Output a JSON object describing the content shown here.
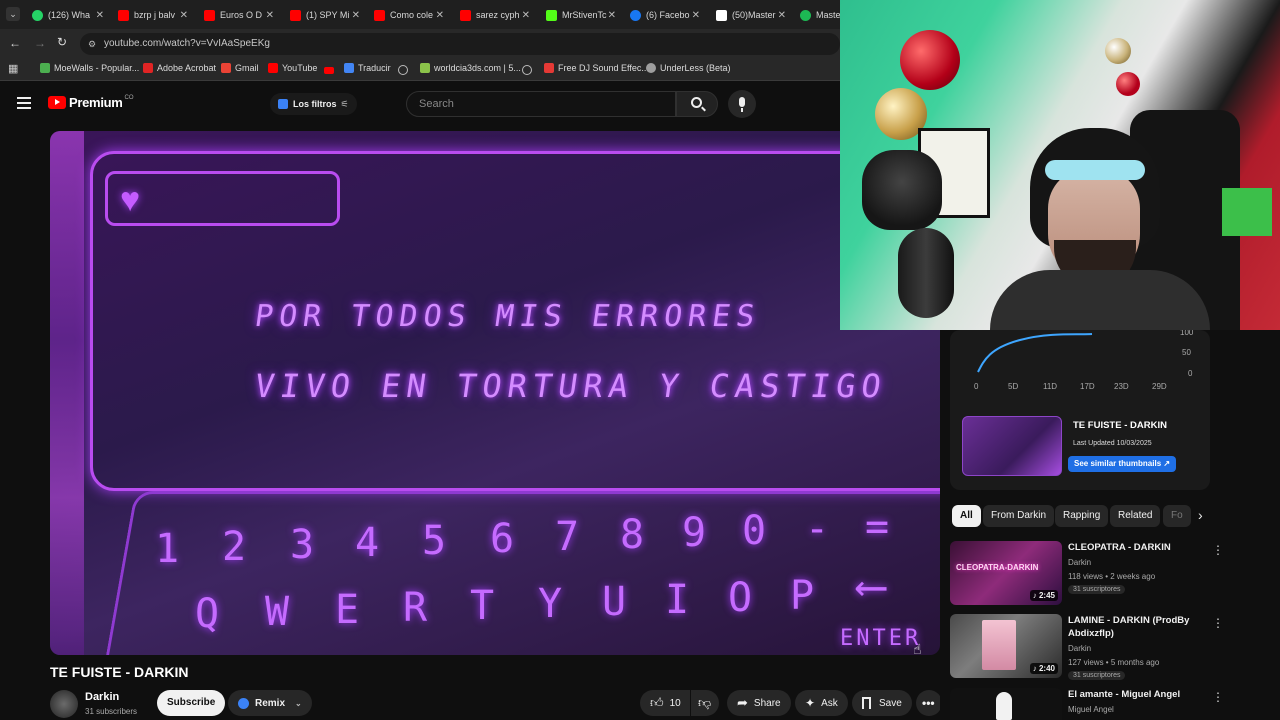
{
  "tabs": [
    {
      "label": "(126) Wha",
      "color": "#25d366"
    },
    {
      "label": "bzrp j balv",
      "color": "#ff0000"
    },
    {
      "label": "Euros O D",
      "color": "#ff0000"
    },
    {
      "label": "(1) SPY Mi",
      "color": "#ff0000"
    },
    {
      "label": "Como cole",
      "color": "#ff0000"
    },
    {
      "label": "sarez cyph",
      "color": "#ff0000"
    },
    {
      "label": "MrStivenTc",
      "color": "#53fc18"
    },
    {
      "label": "(6) Facebo",
      "color": "#1877f2"
    },
    {
      "label": "(50)Master",
      "color": "#ffffff"
    },
    {
      "label": "Master",
      "color": "#1db954"
    }
  ],
  "address": {
    "url": "youtube.com/watch?v=VvIAaSpeEKg"
  },
  "bookmarks": [
    {
      "label": "MoeWalls - Popular...",
      "color": "#4caf50"
    },
    {
      "label": "Adobe Acrobat",
      "color": "#e02424"
    },
    {
      "label": "Gmail",
      "color": "#ea4335"
    },
    {
      "label": "YouTube",
      "color": "#ff0000"
    },
    {
      "label": "Traducir",
      "color": "#4285f4"
    },
    {
      "label": "worldcia3ds.com | 5...",
      "color": "#8bc34a"
    },
    {
      "label": "Free DJ Sound Effec...",
      "color": "#e53935"
    },
    {
      "label": "UnderLess (Beta)",
      "color": "#9e9e9e"
    }
  ],
  "header": {
    "logo_text": "Premium",
    "country": "CO",
    "filters_label": "Los filtros",
    "search_placeholder": "Search"
  },
  "video": {
    "line1": "POR TODOS MIS ERRORES",
    "line2": "VIVO EN TORTURA Y CASTIGO",
    "keys_row1": [
      "1",
      "2",
      "3",
      "4",
      "5",
      "6",
      "7",
      "8",
      "9",
      "0",
      "-",
      "="
    ],
    "keys_row2": [
      "Q",
      "W",
      "E",
      "R",
      "T",
      "Y",
      "U",
      "I",
      "O",
      "P"
    ],
    "enter_key": "ENTER"
  },
  "below_video": {
    "title": "TE FUISTE - DARKIN",
    "channel": "Darkin",
    "subscribers": "31 subscribers",
    "subscribe": "Subscribe",
    "remix": "Remix",
    "likes": "10",
    "share": "Share",
    "ask": "Ask",
    "save": "Save"
  },
  "stats_panel": {
    "y_ticks": [
      "100",
      "50",
      "0"
    ],
    "x_ticks": [
      "0",
      "5D",
      "11D",
      "17D",
      "23D",
      "29D"
    ],
    "video_title": "TE FUISTE - DARKIN",
    "last_updated": "Last Updated 10/03/2025",
    "similar_button": "See similar thumbnails ↗"
  },
  "chips": [
    "All",
    "From Darkin",
    "Rapping",
    "Related",
    "Fo"
  ],
  "related": [
    {
      "title": "CLEOPATRA - DARKIN",
      "channel": "Darkin",
      "meta": "118 views • 2 weeks ago",
      "subs": "31 suscriptores",
      "duration": "2:45",
      "thumb_text": "CLEOPATRA-DARKIN"
    },
    {
      "title": "LAMINE - DARKIN (ProdBy Abdixzflp)",
      "channel": "Darkin",
      "meta": "127 views • 5 months ago",
      "subs": "31 suscriptores",
      "duration": "2:40"
    },
    {
      "title": "El amante - Miguel Angel",
      "channel": "Miguel Angel"
    }
  ]
}
